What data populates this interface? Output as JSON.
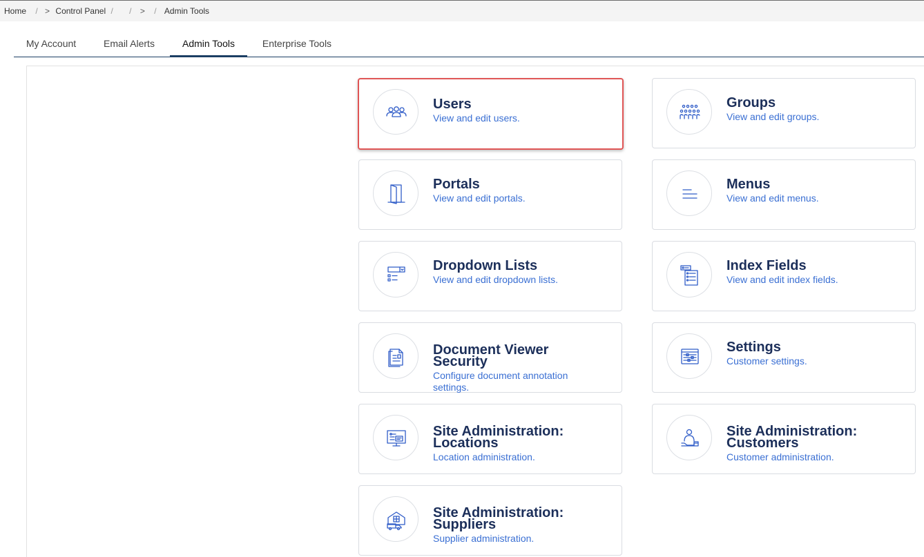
{
  "breadcrumb": {
    "home": "Home",
    "sep": "/",
    "gt": ">",
    "control_panel": "Control Panel",
    "admin_tools": "Admin Tools"
  },
  "tabs": [
    {
      "label": "My Account"
    },
    {
      "label": "Email Alerts"
    },
    {
      "label": "Admin Tools",
      "active": true
    },
    {
      "label": "Enterprise Tools"
    }
  ],
  "cards": {
    "users": {
      "title": "Users",
      "desc": "View and edit users.",
      "icon": "users-icon"
    },
    "groups": {
      "title": "Groups",
      "desc": "View and edit groups.",
      "icon": "groups-icon"
    },
    "portals": {
      "title": "Portals",
      "desc": "View and edit portals.",
      "icon": "door-icon"
    },
    "menus": {
      "title": "Menus",
      "desc": "View and edit menus.",
      "icon": "menu-lines-icon"
    },
    "dropdown_lists": {
      "title": "Dropdown Lists",
      "desc": "View and edit dropdown lists.",
      "icon": "dropdown-list-icon"
    },
    "index_fields": {
      "title": "Index Fields",
      "desc": "View and edit index fields.",
      "icon": "index-fields-icon"
    },
    "doc_viewer_security": {
      "title": "Document Viewer Security",
      "desc": "Configure document annotation settings.",
      "icon": "document-security-icon"
    },
    "settings": {
      "title": "Settings",
      "desc": "Customer settings.",
      "icon": "settings-panel-icon"
    },
    "site_admin_locations": {
      "title": "Site Administration: Locations",
      "desc": "Location administration.",
      "icon": "monitor-icon"
    },
    "site_admin_customers": {
      "title": "Site Administration: Customers",
      "desc": "Customer administration.",
      "icon": "customer-icon"
    },
    "site_admin_suppliers": {
      "title": "Site Administration: Suppliers",
      "desc": "Supplier administration.",
      "icon": "warehouse-truck-icon"
    }
  },
  "colors": {
    "title": "#1c2f5a",
    "description": "#3a6fd3",
    "icon": "#2f5cc8",
    "highlight": "#e05555",
    "tab_underline": "#1b3e63"
  }
}
